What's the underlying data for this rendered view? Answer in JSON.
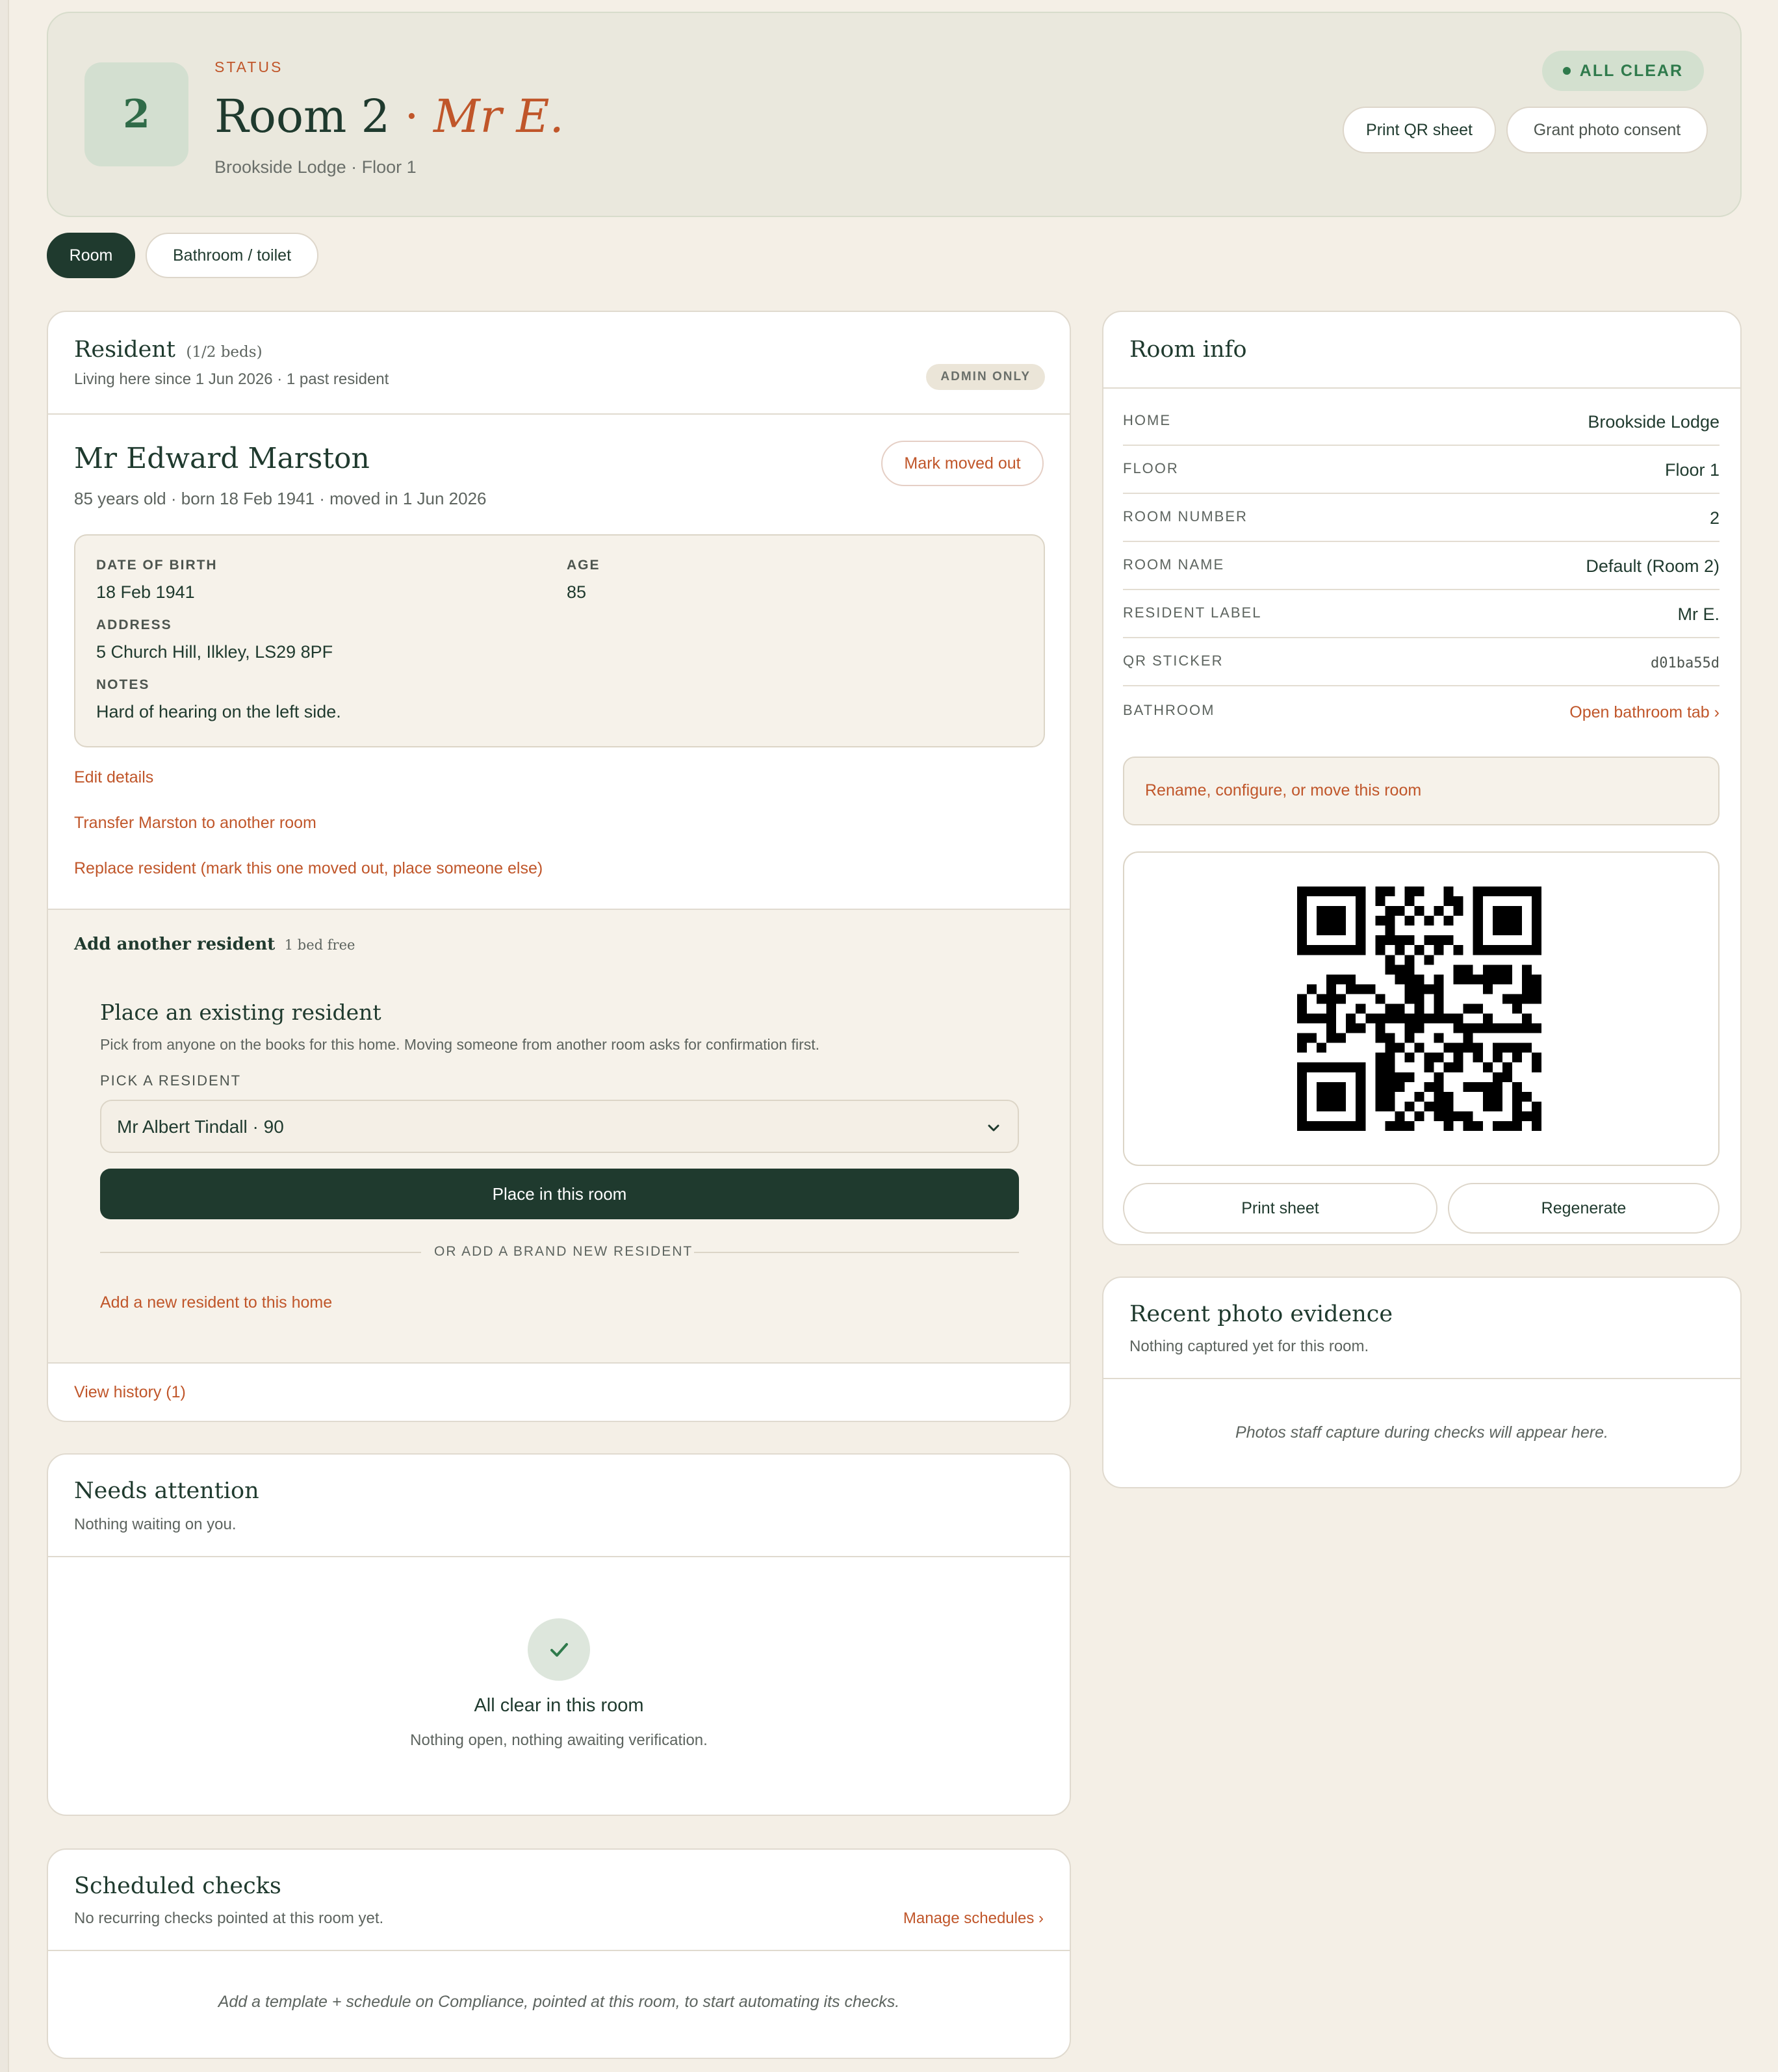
{
  "header": {
    "room_number_badge": "2",
    "status_label": "STATUS",
    "title_room": "Room 2",
    "title_sep": "·",
    "title_resident": "Mr E.",
    "subtitle": "Brookside Lodge · Floor 1",
    "status_badge": "ALL CLEAR",
    "print_qr_label": "Print QR sheet",
    "grant_consent_label": "Grant photo consent"
  },
  "tabs": [
    {
      "label": "Room",
      "active": true
    },
    {
      "label": "Bathroom / toilet",
      "active": false
    }
  ],
  "resident_card": {
    "title": "Resident",
    "beds": "(1/2 beds)",
    "subtitle": "Living here since 1 Jun 2026 · 1 past resident",
    "admin_badge": "ADMIN ONLY",
    "name": "Mr Edward Marston",
    "meta": "85 years old · born 18 Feb 1941 · moved in 1 Jun 2026",
    "mark_moved_out": "Mark moved out",
    "details": {
      "dob_label": "DATE OF BIRTH",
      "dob_value": "18 Feb 1941",
      "age_label": "AGE",
      "age_value": "85",
      "address_label": "ADDRESS",
      "address_value": "5 Church Hill, Ilkley, LS29 8PF",
      "notes_label": "NOTES",
      "notes_value": "Hard of hearing on the left side."
    },
    "edit_details": "Edit details",
    "transfer": "Transfer Marston to another room",
    "replace": "Replace resident (mark this one moved out, place someone else)",
    "add_another_title": "Add another resident",
    "bed_free": "1 bed free",
    "place_existing_title": "Place an existing resident",
    "place_existing_desc": "Pick from anyone on the books for this home. Moving someone from another room asks for confirmation first.",
    "pick_label": "PICK A RESIDENT",
    "pick_selected": "Mr Albert Tindall · 90",
    "place_button": "Place in this room",
    "or_divider": "OR ADD A BRAND NEW RESIDENT",
    "add_new_link": "Add a new resident to this home",
    "view_history": "View history (1)"
  },
  "needs_attention": {
    "title": "Needs attention",
    "subtitle": "Nothing waiting on you.",
    "clear_title": "All clear in this room",
    "clear_desc": "Nothing open, nothing awaiting verification."
  },
  "scheduled_checks": {
    "title": "Scheduled checks",
    "subtitle": "No recurring checks pointed at this room yet.",
    "manage_link": "Manage schedules ›",
    "empty_text": "Add a template + schedule on Compliance, pointed at this room, to start automating its checks."
  },
  "room_info": {
    "title": "Room info",
    "rows": [
      {
        "label": "HOME",
        "value": "Brookside Lodge"
      },
      {
        "label": "FLOOR",
        "value": "Floor 1"
      },
      {
        "label": "ROOM NUMBER",
        "value": "2"
      },
      {
        "label": "ROOM NAME",
        "value": "Default (Room 2)"
      },
      {
        "label": "RESIDENT LABEL",
        "value": "Mr E."
      },
      {
        "label": "QR STICKER",
        "value": "d01ba55d"
      },
      {
        "label": "BATHROOM",
        "value": "Open bathroom tab ›"
      }
    ],
    "configure_link": "Rename, configure, or move this room",
    "print_sheet": "Print sheet",
    "regenerate": "Regenerate"
  },
  "photo_evidence": {
    "title": "Recent photo evidence",
    "subtitle": "Nothing captured yet for this room.",
    "empty_text": "Photos staff capture during checks will appear here."
  },
  "colors": {
    "accent": "#c0562a",
    "dark_green": "#1f3a2e",
    "status_green": "#2f7a4c",
    "background": "#f4efe6"
  },
  "icons": {
    "dropdown": "chevron-down-icon",
    "clear": "check-icon",
    "status_dot": "status-dot-icon",
    "qr": "qr-code-icon"
  }
}
